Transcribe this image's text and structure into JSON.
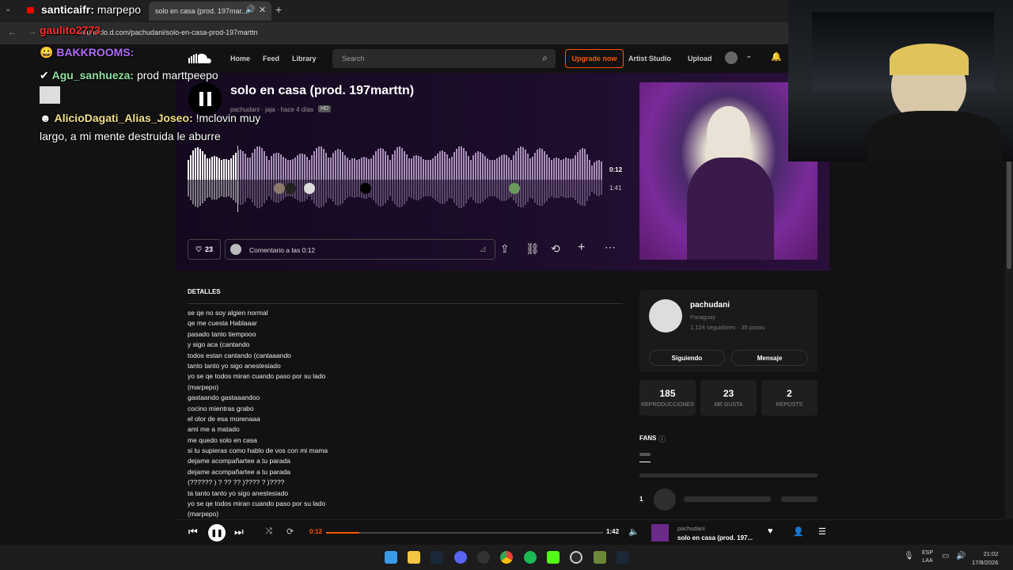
{
  "browser": {
    "tabs": [
      {
        "label": "solo en casa (prod. 197mar..."
      }
    ],
    "url": "soundcloud.com/pachudani/solo-en-casa-prod-197marttn",
    "url_visible": "soundclo.d.com/pachudani/solo-en-casa-prod-197marttn"
  },
  "chat": {
    "messages": [
      {
        "user": "santicaifr:",
        "text": "marpepo",
        "user_color": "#ffffff"
      },
      {
        "user": "gaulito2773",
        "text": "",
        "user_color": "#ff2d2d"
      },
      {
        "user": "BAKKROOMS:",
        "text": "",
        "user_color": "#b36bff"
      },
      {
        "user": "Agu_sanhueza:",
        "text": "prod marttpeepo",
        "user_color": "#8fe0a0"
      },
      {
        "user": "AlicioDagati_Alias_Joseo:",
        "text": "!mclovin muy largo, a mi mente destruida le aburre",
        "user_color": "#f2e08a"
      }
    ]
  },
  "soundcloud": {
    "nav": {
      "home": "Home",
      "feed": "Feed",
      "library": "Library",
      "search_placeholder": "Search",
      "upgrade": "Upgrade now",
      "artist_studio": "Artist Studio",
      "upload": "Upload"
    },
    "track": {
      "title": "solo en casa (prod. 197marttn)",
      "meta": "pachudani · jaja · hace 4 días",
      "quality": "HD",
      "time_current": "0:12",
      "time_total": "1:41",
      "likes": "23",
      "comment_placeholder": "Comentario a las 0:12",
      "played_fraction": 0.12
    },
    "details": {
      "heading": "DETALLES",
      "lyrics": [
        "se qe no soy algien normal",
        "qe me cuesta Hablaaar",
        "pasado tanto tiempooo",
        "y sigo aca (cantando",
        "todos estan cantando (cantaaando",
        "tanto tanto yo sigo anestesiado",
        "yo se qe todos miran cuando paso por su lado",
        "(marpepo)",
        "gastaando gastaaandoo",
        "cocino mientras grabo",
        "el olor de esa morenaaa",
        "ami me a matado",
        "me quedo solo en casa",
        "si tu supieras como hablo de vos con mi mama",
        "dejame acompañartee a tu parada",
        "dejame acompañartee a tu parada",
        "(?????? ) ? ?? ?? )???? ? )????",
        "ta tanto tanto yo sigo anestesiado",
        "yo se qe todos miran cuando paso por su lado",
        "(marpepo)"
      ]
    },
    "artist": {
      "name": "pachudani",
      "country": "Paraguay",
      "followers": "1.124 seguidores · 35 pistas",
      "following_label": "Siguiendo",
      "message_label": "Mensaje"
    },
    "stats": [
      {
        "value": "185",
        "label": "REPRODUCCIONES"
      },
      {
        "value": "23",
        "label": "ME GUSTA"
      },
      {
        "value": "2",
        "label": "REPOSTS"
      }
    ],
    "fans_heading": "FANS",
    "fans_rank": "1"
  },
  "player": {
    "time_current": "0:12",
    "time_total": "1:42",
    "progress": 0.12,
    "artist": "pachudani",
    "title": "solo en casa (prod. 197..."
  },
  "taskbar": {
    "lang": "ESP",
    "layout": "LAA",
    "time": "21:02",
    "date": "17/8/2026"
  },
  "colors": {
    "accent": "#ff5500",
    "hero_purple": "#1d0d2b",
    "background": "#121212"
  }
}
